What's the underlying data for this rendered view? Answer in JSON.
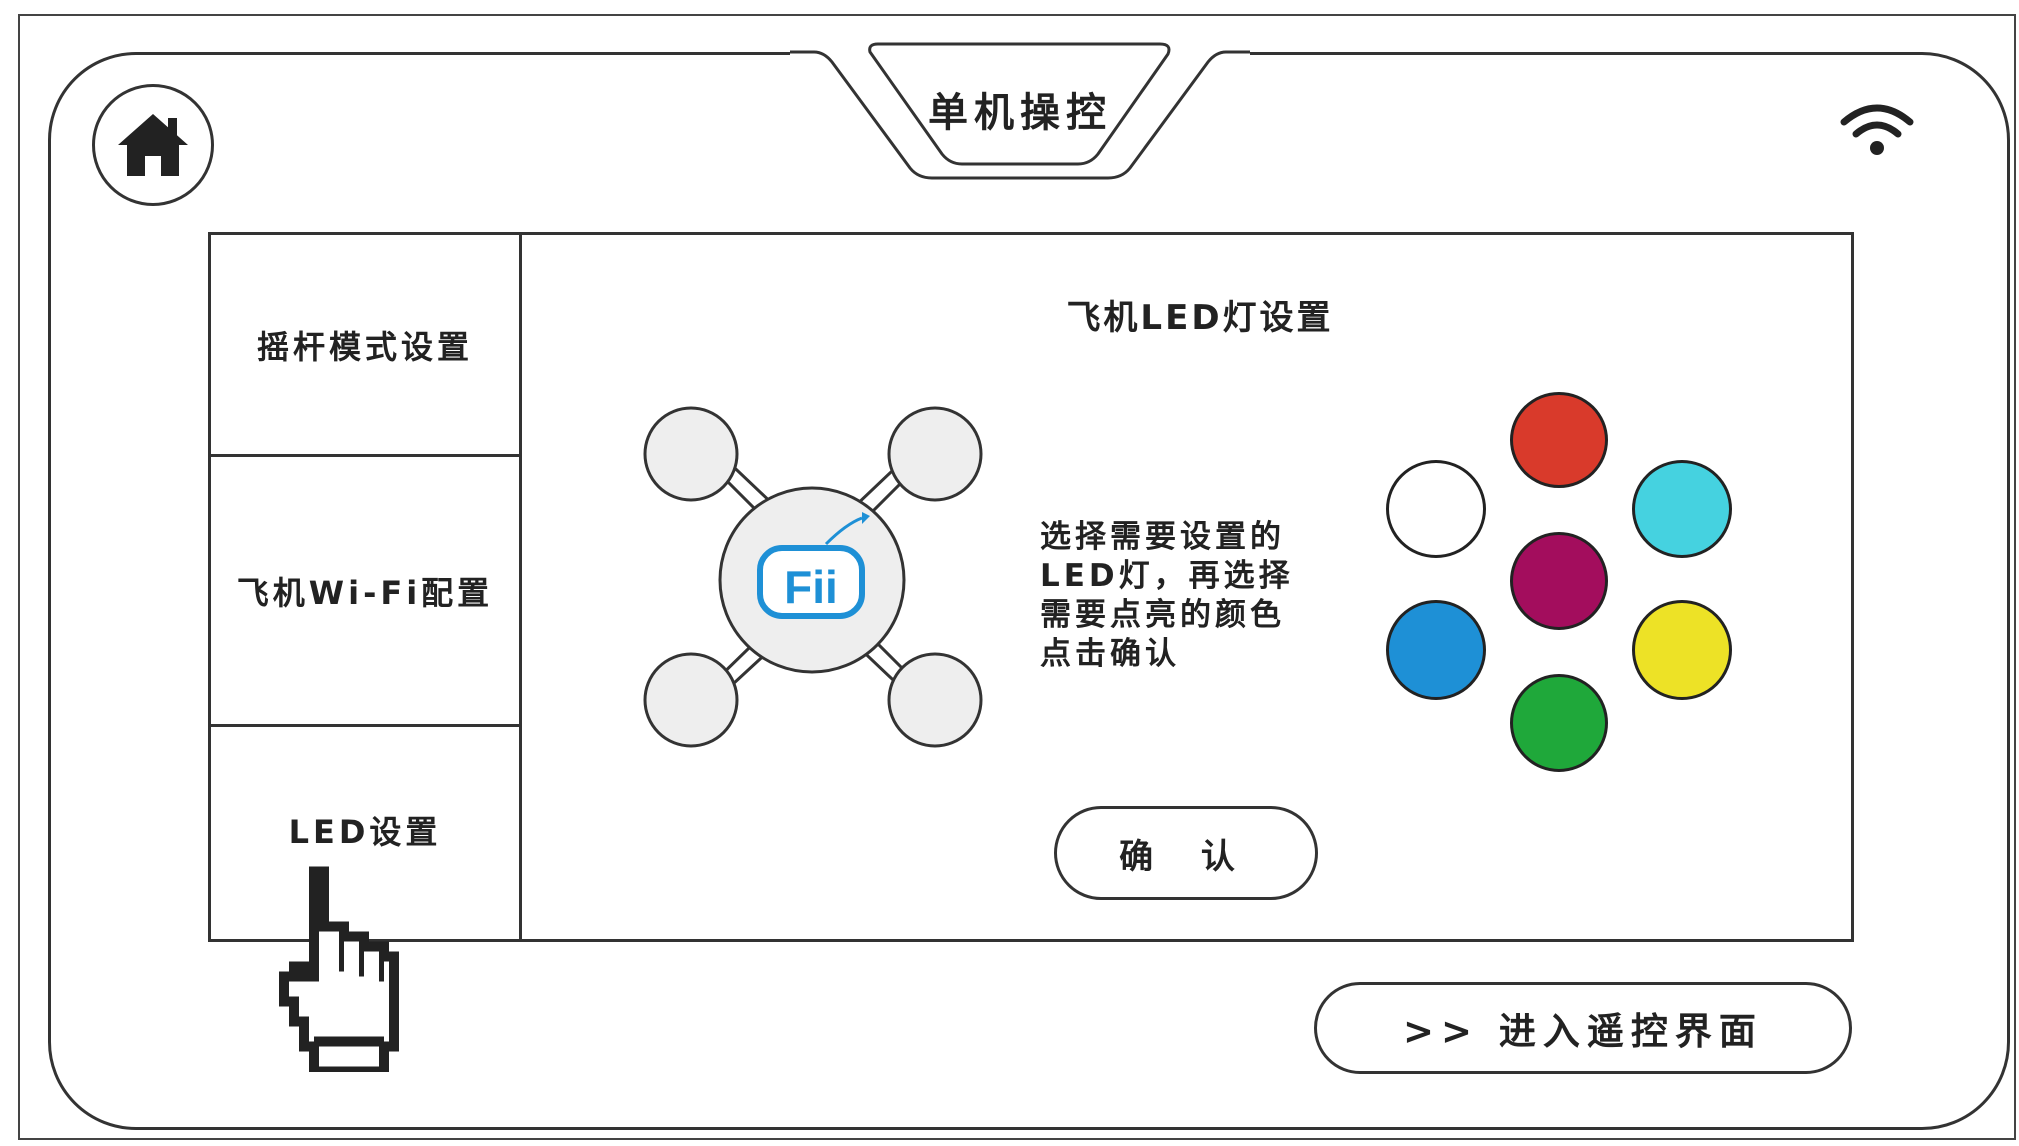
{
  "header": {
    "title": "单机操控",
    "home_icon": "home-icon",
    "wifi_icon": "wifi-icon"
  },
  "sidebar": {
    "items": [
      {
        "label": "摇杆模式设置"
      },
      {
        "label": "飞机Wi-Fi配置"
      },
      {
        "label": "LED设置",
        "selected": true
      }
    ]
  },
  "panel": {
    "title": "飞机LED灯设置",
    "drone_logo": "Fii",
    "instructions": [
      "选择需要设置的",
      "LED灯，再选择",
      "需要点亮的颜色",
      "点击确认"
    ],
    "colors": [
      {
        "name": "red",
        "hex": "#d93a2b"
      },
      {
        "name": "white",
        "hex": "#ffffff"
      },
      {
        "name": "cyan",
        "hex": "#45d2e0"
      },
      {
        "name": "magenta",
        "hex": "#a30d5d"
      },
      {
        "name": "blue",
        "hex": "#1e90d6"
      },
      {
        "name": "yellow",
        "hex": "#ede226"
      },
      {
        "name": "green",
        "hex": "#1fa83a"
      }
    ],
    "confirm_label": "确 认"
  },
  "footer": {
    "enter_label": ">> 进入遥控界面"
  },
  "colors": {
    "outline": "#333333",
    "drone_fill": "#eeeeee",
    "logo_blue": "#1e90d6"
  }
}
